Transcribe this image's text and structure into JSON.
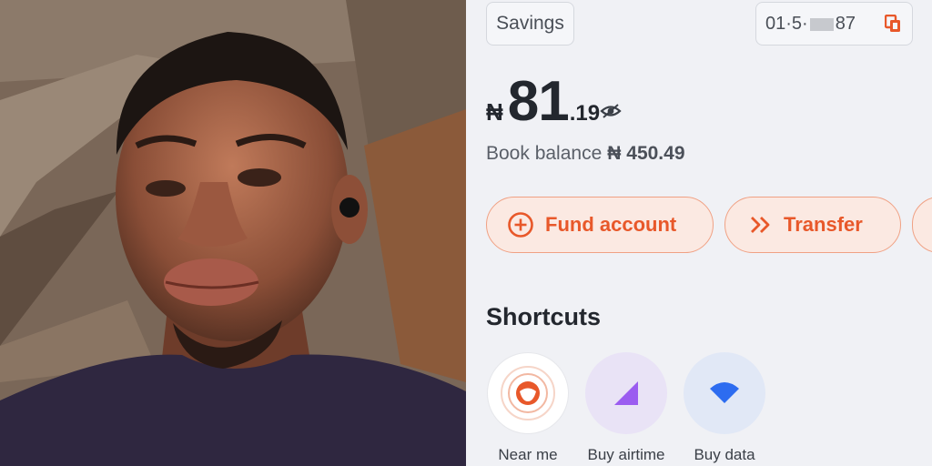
{
  "account": {
    "type_label": "Savings",
    "number_prefix": "01·5·",
    "number_suffix": "87"
  },
  "balance": {
    "currency_symbol": "₦",
    "main": "81",
    "decimal": ".19"
  },
  "book_balance": {
    "label": "Book balance",
    "value": "₦ 450.49"
  },
  "actions": [
    {
      "label": "Fund account",
      "icon": "plus-circle-icon"
    },
    {
      "label": "Transfer",
      "icon": "double-chevron-right-icon"
    },
    {
      "label": "",
      "icon": ""
    }
  ],
  "shortcuts": {
    "title": "Shortcuts",
    "items": [
      {
        "label": "Near me",
        "icon": "near-me-face-icon"
      },
      {
        "label": "Buy airtime",
        "icon": "signal-bars-icon"
      },
      {
        "label": "Buy data",
        "icon": "wifi-icon"
      }
    ]
  },
  "colors": {
    "accent": "#e8582a",
    "pill_bg": "#fbe9e2",
    "airtime_purple": "#9b5cf0",
    "data_blue": "#2d6cf0"
  }
}
